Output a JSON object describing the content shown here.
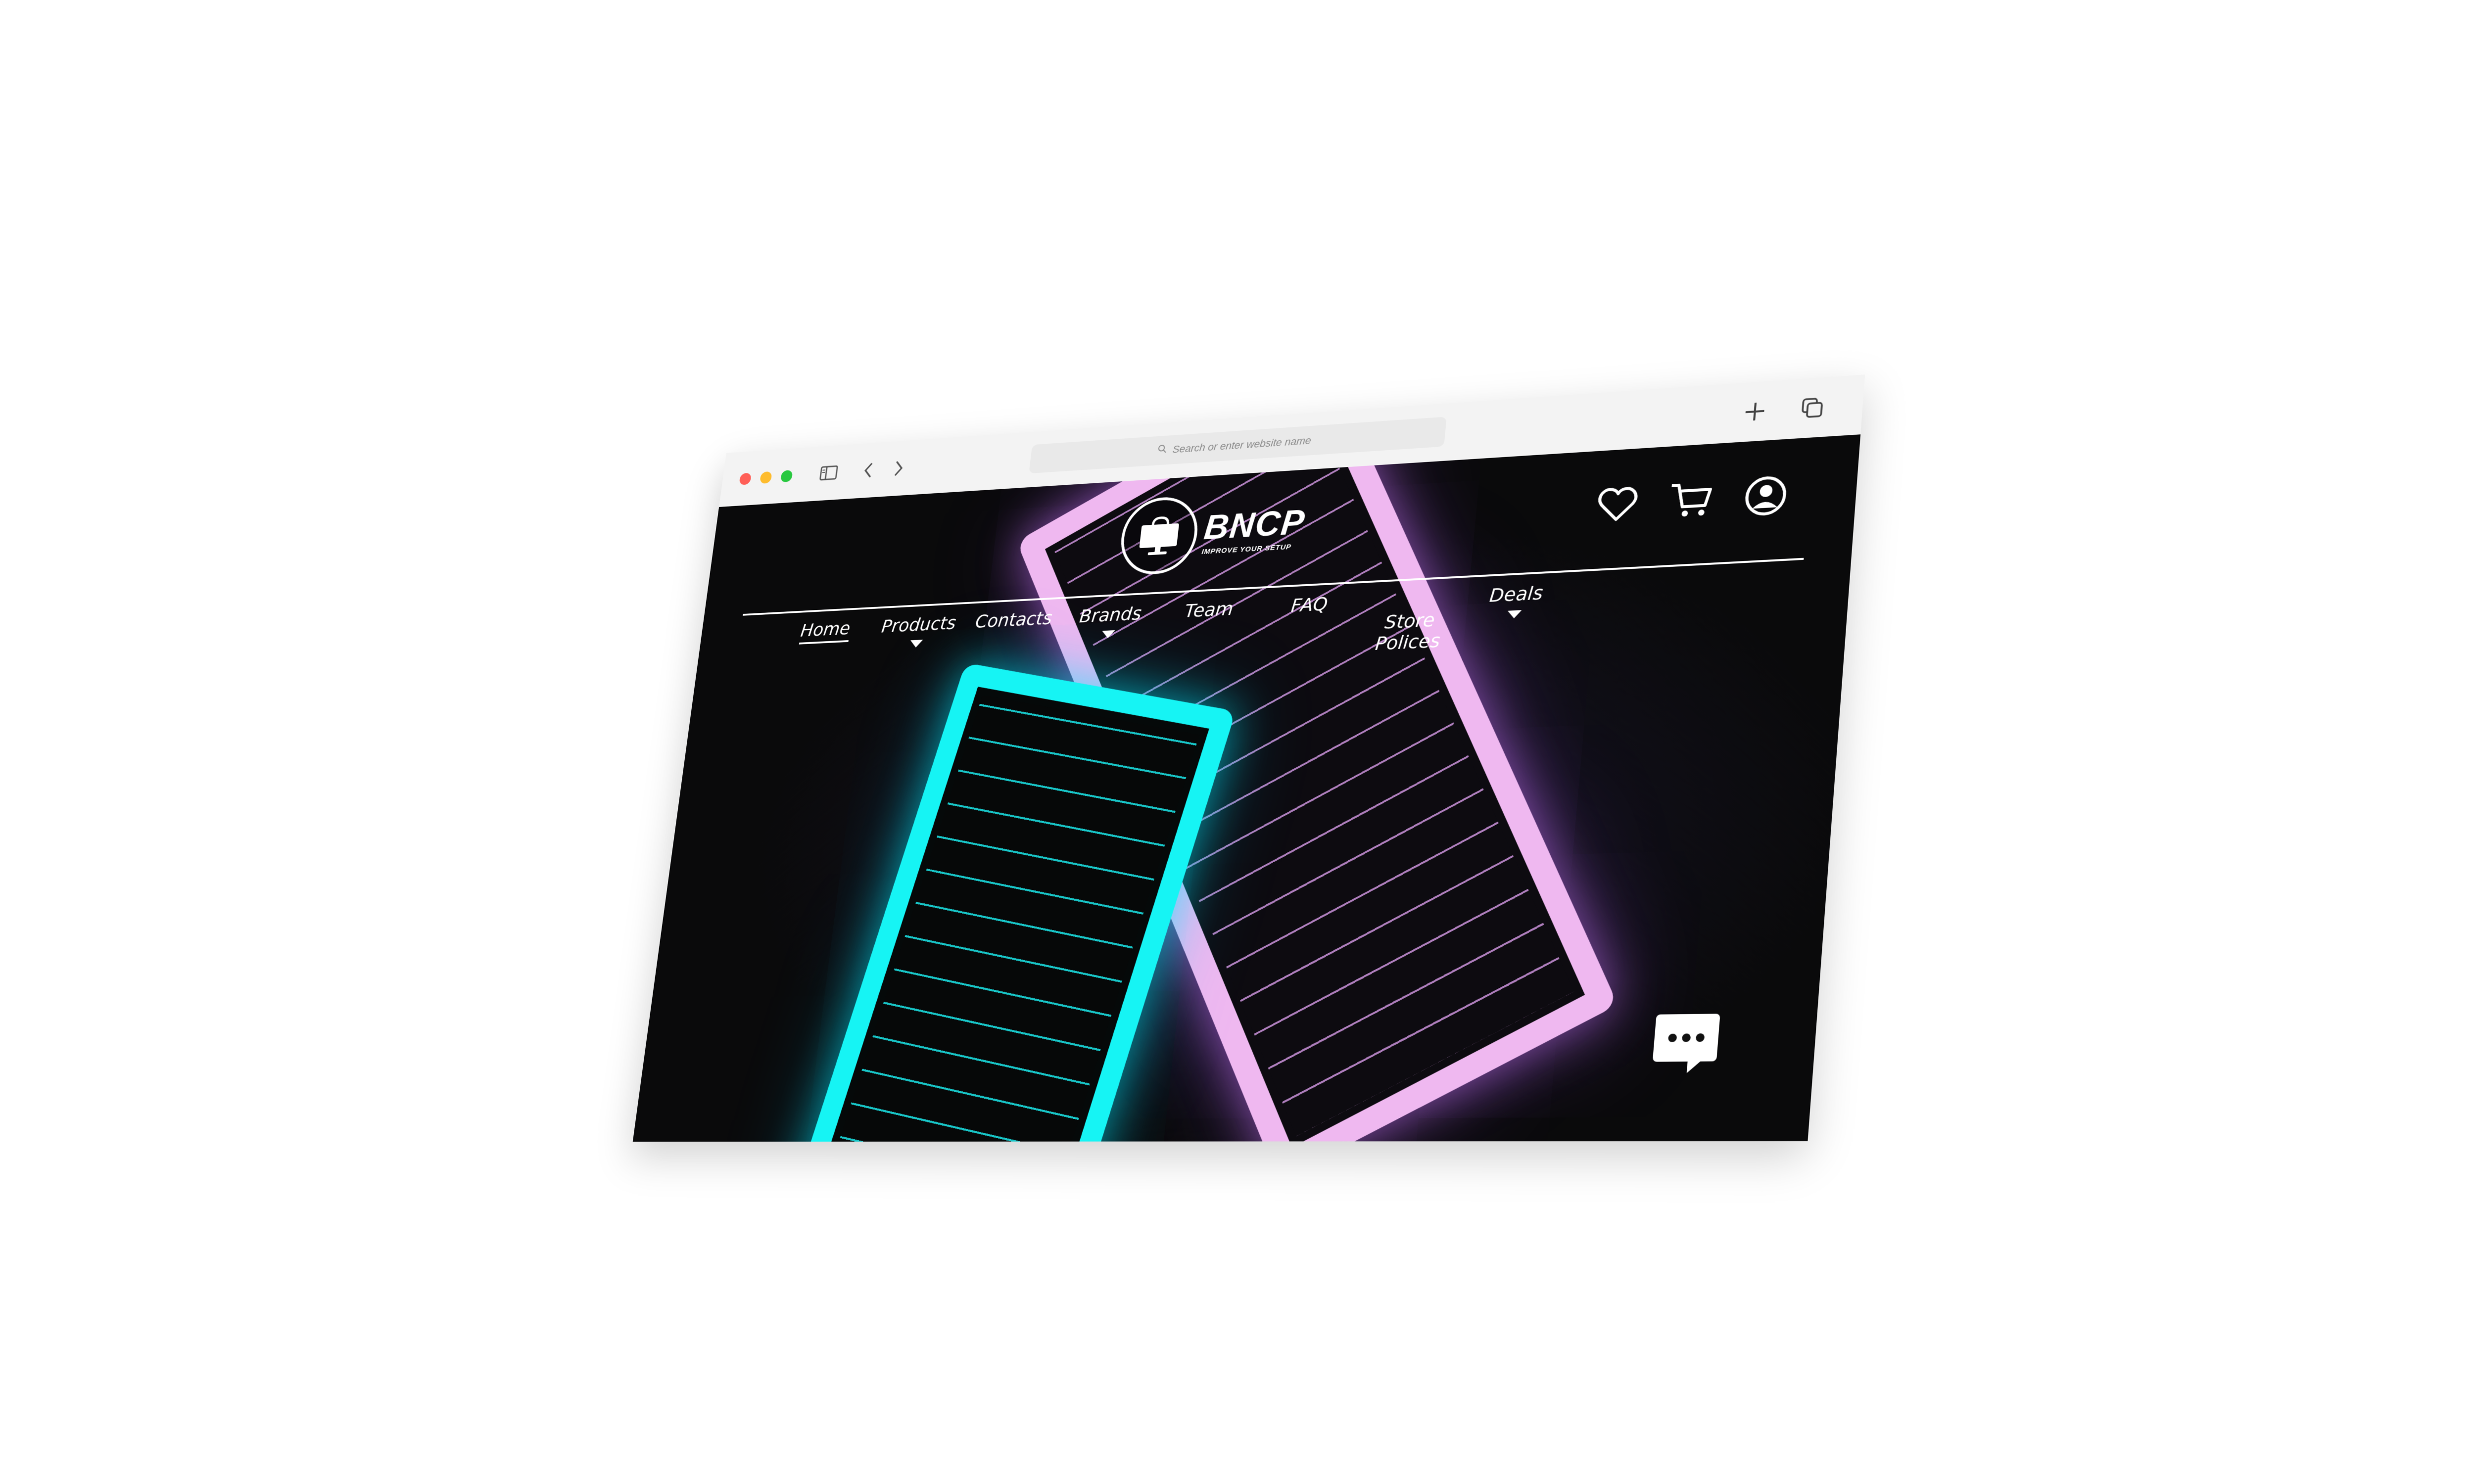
{
  "browser": {
    "address_placeholder": "Search or enter website name",
    "icons": [
      "sidebar-icon",
      "back-icon",
      "forward-icon",
      "new-tab-icon",
      "tabs-overview-icon"
    ]
  },
  "site": {
    "brand": "BNCP",
    "tagline": "IMPROVE YOUR SETUP",
    "header_icons": [
      "heart-icon",
      "cart-icon",
      "account-icon"
    ],
    "nav": [
      {
        "label": "Home",
        "active": true,
        "dropdown": false
      },
      {
        "label": "Products",
        "active": false,
        "dropdown": true
      },
      {
        "label": "Contacts",
        "active": false,
        "dropdown": false
      },
      {
        "label": "Brands",
        "active": false,
        "dropdown": true
      },
      {
        "label": "Team",
        "active": false,
        "dropdown": false
      },
      {
        "label": "FAQ",
        "active": false,
        "dropdown": false
      },
      {
        "label": "Store\nPolices",
        "active": false,
        "dropdown": false
      },
      {
        "label": "Deals",
        "active": false,
        "dropdown": true
      }
    ],
    "chat_icon": "chat-bubble-icon"
  },
  "colors": {
    "accent_cyan": "#16f4f4",
    "accent_pink": "#efb8f0",
    "page_bg": "#0b0b0c",
    "toolbar_bg": "#f3f3f3"
  }
}
